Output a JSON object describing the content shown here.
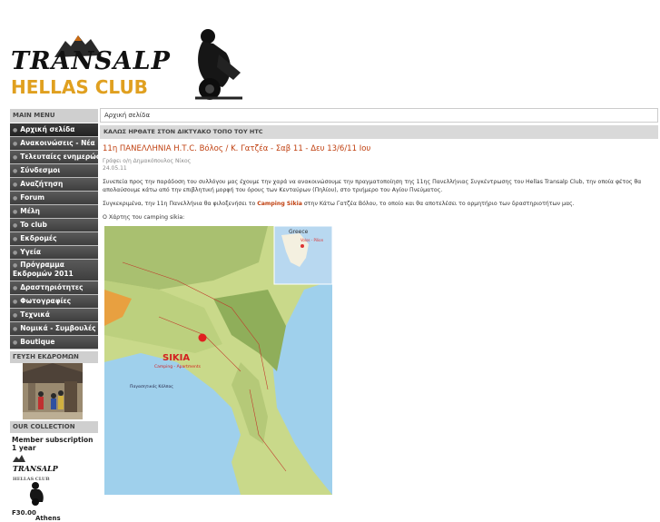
{
  "header": {
    "logo_main": "TRANSALP",
    "logo_sub": "HELLAS CLUB"
  },
  "sidebar": {
    "menu_title": "MAIN MENU",
    "items": [
      {
        "label": "Αρχική σελίδα"
      },
      {
        "label": "Ανακοινώσεις - Νέα"
      },
      {
        "label": "Τελευταίες ενημερώσεις"
      },
      {
        "label": "Σύνδεσμοι"
      },
      {
        "label": "Αναζήτηση"
      },
      {
        "label": "Forum"
      },
      {
        "label": "Μέλη"
      },
      {
        "label": "To club"
      },
      {
        "label": "Εκδρομές"
      },
      {
        "label": "Υγεία"
      },
      {
        "label": "Πρόγραμμα Εκδρομών 2011"
      },
      {
        "label": "Δραστηριότητες"
      },
      {
        "label": "Φωτογραφίες"
      },
      {
        "label": "Τεχνικά"
      },
      {
        "label": "Νομικά - Συμβουλές"
      },
      {
        "label": "Boutique"
      }
    ],
    "gallery_title": "ΓΕΥΣΗ ΕΚΔΡΟΜΩΝ",
    "collection_title": "OUR COLLECTION",
    "member_text": "Member subscription 1 year",
    "mini_logo": "TRANSALP",
    "mini_logo_sub": "HELLAS CLUB",
    "price": "F30.00",
    "next_text": "Athens"
  },
  "content": {
    "breadcrumb": "Αρχική σελίδα",
    "welcome": "ΚΑΛΩΣ ΗΡΘΑΤΕ ΣΤΟΝ ΔΙΚΤΥΑΚΟ ΤΟΠΟ ΤΟΥ HTC",
    "title": "11η ΠΑΝΕΛΛΗΝΙΑ Η.Τ.C. Βόλος / Κ. Γατζέα - Σαβ 11 - Δευ 13/6/11 Ιου",
    "author": "Γράφει ο/η Δημακόπουλος Νίκος",
    "date": "24.05.11",
    "para1": "Συνεπεία προς την παράδοση του συλλόγου μας έχουμε την χαρά να ανακοινώσουμε την πραγματοποίηση της 11ης Πανελλήνιας Συγκέντρωσης του Hellas Transalp Club, την οποία φέτος θα απολαύσουμε κάτω από την επιβλητική μορφή του όρους των Κενταύρων (Πηλίου), στο τριήμερο του Αγίου Πνεύματος.",
    "para2_a": "Συγκεκριμένα, την 11η Πανελλήνια θα φιλοξενήσει το ",
    "para2_link": "Camping Sikia",
    "para2_b": " στην Κάτω Γατζέα Βόλου, το οποίο και θα αποτελέσει το ορμητήριο των δραστηριοτήτων μας.",
    "para3": "Ο Χάρτης του camping sikia:",
    "map": {
      "inset_label": "Greece",
      "inset_city": "Volos - Pilion",
      "brand": "SIKIA",
      "brand_sub": "Camping - Apartments",
      "sea_label": "Παγασητικός Κόλπος"
    }
  }
}
